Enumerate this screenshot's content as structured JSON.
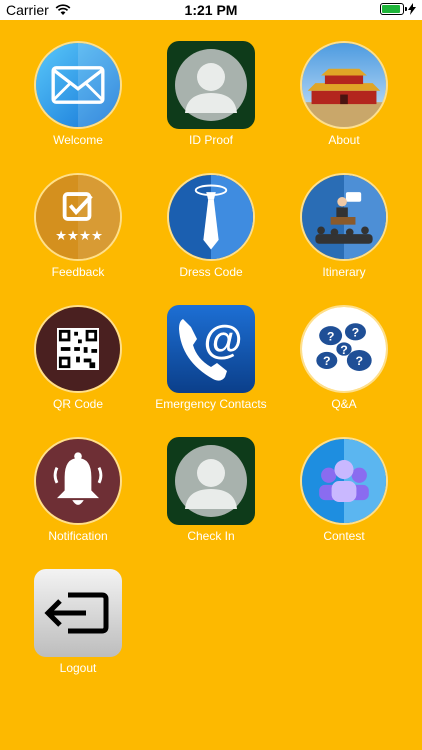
{
  "status_bar": {
    "carrier": "Carrier",
    "time": "1:21 PM",
    "battery_level": 0.9
  },
  "tiles": [
    {
      "label": "Welcome",
      "icon": "envelope-icon"
    },
    {
      "label": "ID Proof",
      "icon": "person-silhouette-icon"
    },
    {
      "label": "About",
      "icon": "palace-icon"
    },
    {
      "label": "Feedback",
      "icon": "rating-checkbox-icon"
    },
    {
      "label": "Dress Code",
      "icon": "necktie-icon"
    },
    {
      "label": "Itinerary",
      "icon": "presentation-icon"
    },
    {
      "label": "QR Code",
      "icon": "qr-code-icon"
    },
    {
      "label": "Emergency Contacts",
      "icon": "phone-at-icon"
    },
    {
      "label": "Q&A",
      "icon": "question-bubbles-icon"
    },
    {
      "label": "Notification",
      "icon": "bell-icon"
    },
    {
      "label": "Check In",
      "icon": "person-silhouette-icon"
    },
    {
      "label": "Contest",
      "icon": "group-icon"
    },
    {
      "label": "Logout",
      "icon": "logout-icon"
    }
  ],
  "colors": {
    "background": "#FDB900",
    "label": "#FFFFFF"
  }
}
